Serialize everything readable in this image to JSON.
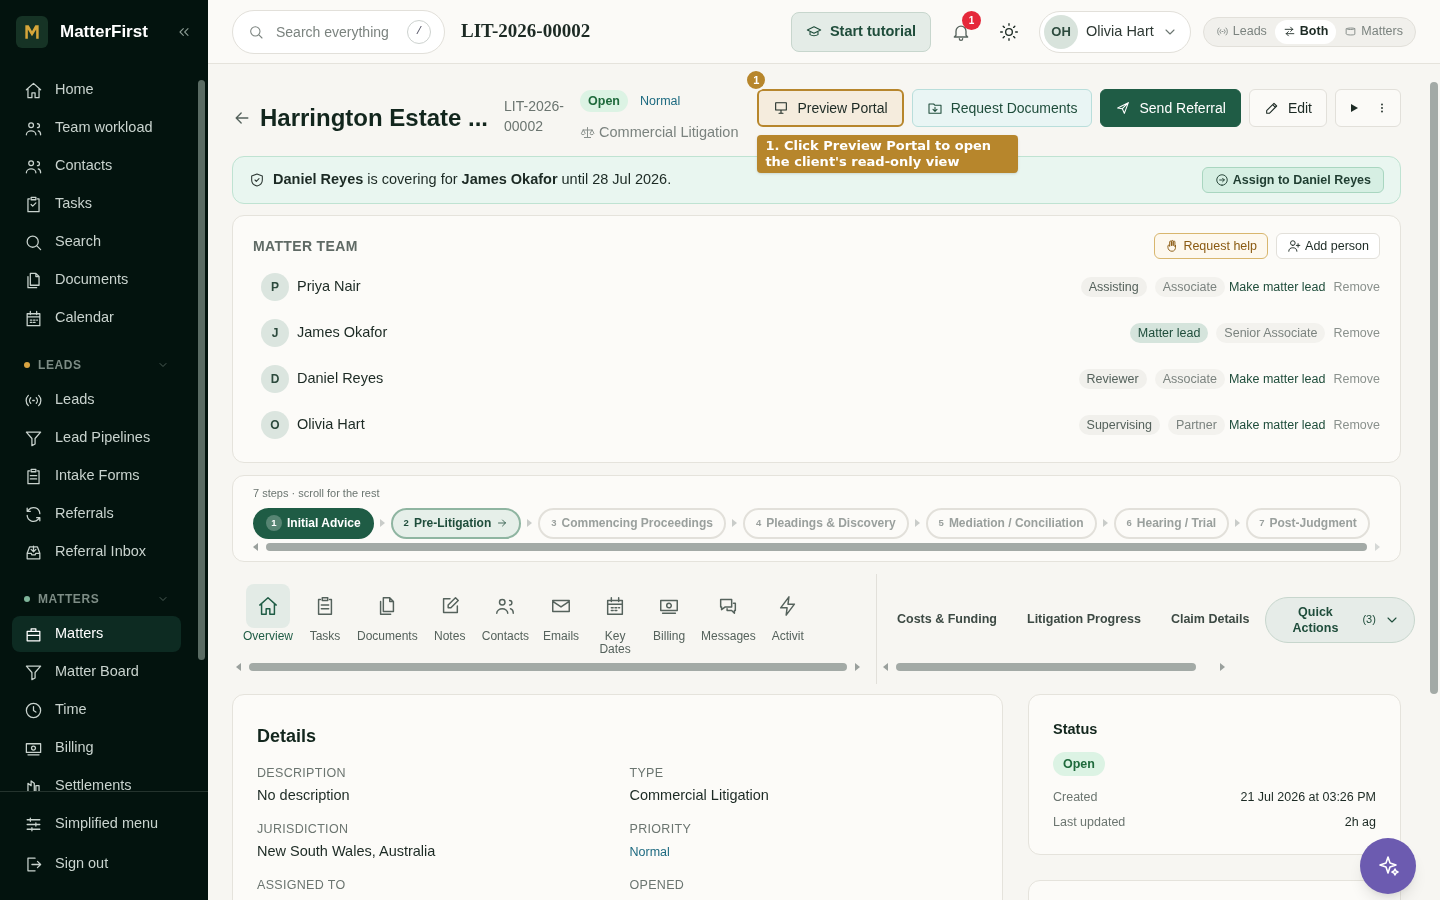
{
  "sidebar": {
    "brand": "MatterFirst",
    "groups": [
      {
        "items": [
          {
            "label": "Home",
            "selected": false
          },
          {
            "label": "Team workload",
            "selected": false
          },
          {
            "label": "Contacts",
            "selected": false
          },
          {
            "label": "Tasks",
            "selected": false
          },
          {
            "label": "Search",
            "selected": false
          },
          {
            "label": "Documents",
            "selected": false
          },
          {
            "label": "Calendar",
            "selected": false
          }
        ]
      },
      {
        "heading": "LEADS",
        "color": "#d9a441",
        "items": [
          {
            "label": "Leads",
            "selected": false
          },
          {
            "label": "Lead Pipelines",
            "selected": false
          },
          {
            "label": "Intake Forms",
            "selected": false
          },
          {
            "label": "Referrals",
            "selected": false
          },
          {
            "label": "Referral Inbox",
            "selected": false
          }
        ]
      },
      {
        "heading": "MATTERS",
        "color": "#7fb59a",
        "items": [
          {
            "label": "Matters",
            "selected": true
          },
          {
            "label": "Matter Board",
            "selected": false
          },
          {
            "label": "Time",
            "selected": false
          },
          {
            "label": "Billing",
            "selected": false
          },
          {
            "label": "Settlements",
            "selected": false
          }
        ]
      }
    ],
    "footer": [
      "Simplified menu",
      "Sign out"
    ]
  },
  "topbar": {
    "search": {
      "placeholder": "Search everything",
      "shortcut": "/"
    },
    "page_code": "LIT-2026-00002",
    "tutorial_button": "Start tutorial",
    "notifications": "1",
    "user": {
      "initials": "OH",
      "name": "Olivia Hart"
    },
    "view_toggle": [
      {
        "label": "Leads",
        "selected": false
      },
      {
        "label": "Both",
        "selected": true
      },
      {
        "label": "Matters",
        "selected": false
      }
    ]
  },
  "header": {
    "title": "Harrington Estate ...",
    "reference": "LIT-2026-00002",
    "status": "Open",
    "priority": "Normal",
    "type": "Commercial Litigation",
    "actions": [
      {
        "kind": "highlight",
        "label": "Preview Portal"
      },
      {
        "kind": "soft",
        "label": "Request Documents"
      },
      {
        "kind": "primary",
        "label": "Send Referral"
      },
      {
        "kind": "plain",
        "label": "Edit"
      },
      {
        "kind": "menu"
      }
    ],
    "tutorial": {
      "step": "1",
      "tip": "1. Click Preview Portal to open the client's read-only view"
    }
  },
  "cover_banner": {
    "text": "**Daniel Reyes** is covering for **James Okafor** until 28 Jul 2026.",
    "button": "Assign to Daniel Reyes"
  },
  "matter_team": {
    "title": "MATTER TEAM",
    "request_help": "Request help",
    "add_person": "Add person",
    "members": [
      {
        "initial": "P",
        "name": "Priya Nair",
        "role": "Assisting",
        "lead": false,
        "position": "Associate",
        "make_lead": "Make matter lead",
        "remove": "Remove"
      },
      {
        "initial": "J",
        "name": "James Okafor",
        "role": "Matter lead",
        "lead": true,
        "position": "Senior Associate",
        "remove": "Remove"
      },
      {
        "initial": "D",
        "name": "Daniel Reyes",
        "role": "Reviewer",
        "lead": false,
        "position": "Associate",
        "make_lead": "Make matter lead",
        "remove": "Remove"
      },
      {
        "initial": "O",
        "name": "Olivia Hart",
        "role": "Supervising",
        "lead": false,
        "position": "Partner",
        "make_lead": "Make matter lead",
        "remove": "Remove"
      }
    ]
  },
  "stages": {
    "caption": "7 steps · scroll for the rest",
    "steps": [
      {
        "number": "1",
        "label": "Initial Advice",
        "completed": true,
        "selected": false
      },
      {
        "number": "2",
        "label": "Pre-Litigation",
        "completed": false,
        "selected": true
      },
      {
        "number": "3",
        "label": "Commencing Proceedings",
        "completed": false,
        "selected": false
      },
      {
        "number": "4",
        "label": "Pleadings & Discovery",
        "completed": false,
        "selected": false
      },
      {
        "number": "5",
        "label": "Mediation / Conciliation",
        "completed": false,
        "selected": false
      },
      {
        "number": "6",
        "label": "Hearing / Trial",
        "completed": false,
        "selected": false
      },
      {
        "number": "7",
        "label": "Post-Judgment",
        "completed": false,
        "selected": false
      }
    ]
  },
  "tabs": [
    {
      "label": "Overview",
      "selected": true
    },
    {
      "label": "Tasks",
      "selected": false
    },
    {
      "label": "Documents",
      "selected": false
    },
    {
      "label": "Notes",
      "selected": false
    },
    {
      "label": "Contacts",
      "selected": false
    },
    {
      "label": "Emails",
      "selected": false
    },
    {
      "label": "Key Dates",
      "selected": false
    },
    {
      "label": "Billing",
      "selected": false
    },
    {
      "label": "Messages",
      "selected": false
    },
    {
      "label": "Activit",
      "selected": false
    }
  ],
  "section_tabs": [
    "Costs & Funding",
    "Litigation Progress",
    "Claim Details"
  ],
  "quick_actions": {
    "label": "Quick Actions",
    "count": "(3)"
  },
  "details": {
    "title": "Details",
    "fields": [
      {
        "label": "DESCRIPTION",
        "value": "No description",
        "kind": "text"
      },
      {
        "label": "TYPE",
        "value": "Commercial Litigation",
        "kind": "text"
      },
      {
        "label": "JURISDICTION",
        "value": "New South Wales, Australia",
        "kind": "text"
      },
      {
        "label": "PRIORITY",
        "value": "Normal",
        "kind": "priority"
      },
      {
        "label": "ASSIGNED TO"
      },
      {
        "label": "OPENED"
      }
    ]
  },
  "status_card": {
    "title": "Status",
    "status": "Open",
    "rows": [
      {
        "label": "Created",
        "value": "21 Jul 2026 at 03:26 PM"
      },
      {
        "label": "Last updated",
        "value": "2h ag"
      }
    ]
  }
}
